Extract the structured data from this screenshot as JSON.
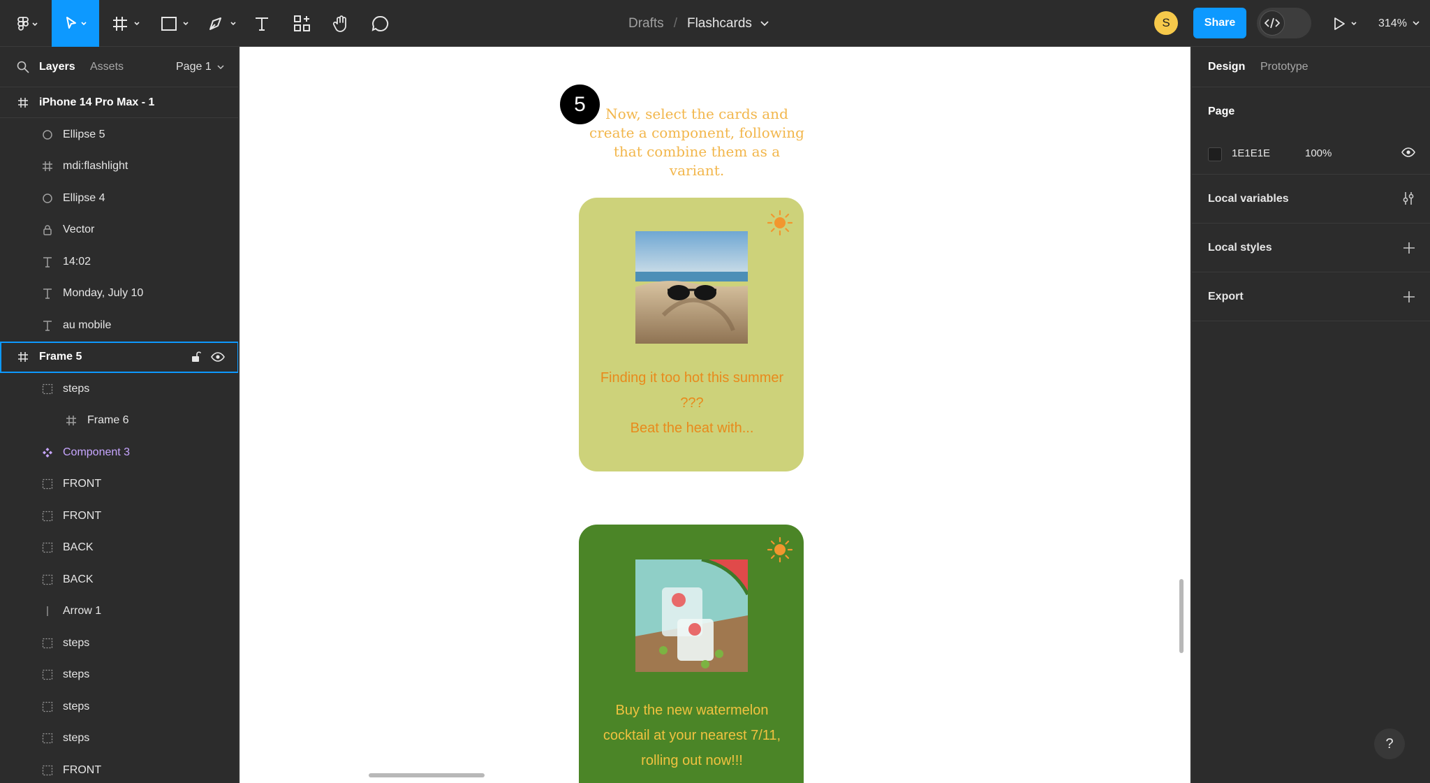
{
  "toolbar": {
    "breadcrumb_parent": "Drafts",
    "breadcrumb_sep": "/",
    "file_name": "Flashcards",
    "avatar_initial": "S",
    "share_label": "Share",
    "zoom": "314%"
  },
  "left_panel": {
    "tab_layers": "Layers",
    "tab_assets": "Assets",
    "page_selector": "Page 1",
    "root_frame": "iPhone 14 Pro Max - 1",
    "layers": [
      {
        "label": "Ellipse 5",
        "icon": "ellipse-icon"
      },
      {
        "label": "mdi:flashlight",
        "icon": "frame-icon"
      },
      {
        "label": "Ellipse 4",
        "icon": "ellipse-icon"
      },
      {
        "label": "Vector",
        "icon": "vector-icon"
      },
      {
        "label": "14:02",
        "icon": "text-icon"
      },
      {
        "label": "Monday, July 10",
        "icon": "text-icon"
      },
      {
        "label": "au mobile",
        "icon": "text-icon"
      },
      {
        "label": "Frame 5",
        "icon": "frame-icon"
      },
      {
        "label": "steps",
        "icon": "group-icon"
      },
      {
        "label": "Frame 6",
        "icon": "frame-icon"
      },
      {
        "label": "Component 3",
        "icon": "component-icon"
      },
      {
        "label": "FRONT",
        "icon": "group-icon"
      },
      {
        "label": "FRONT",
        "icon": "group-icon"
      },
      {
        "label": "BACK",
        "icon": "group-icon"
      },
      {
        "label": "BACK",
        "icon": "group-icon"
      },
      {
        "label": "Arrow 1",
        "icon": "line-icon"
      },
      {
        "label": "steps",
        "icon": "group-icon"
      },
      {
        "label": "steps",
        "icon": "group-icon"
      },
      {
        "label": "steps",
        "icon": "group-icon"
      },
      {
        "label": "steps",
        "icon": "group-icon"
      },
      {
        "label": "FRONT",
        "icon": "group-icon"
      }
    ]
  },
  "canvas": {
    "step_number": "5",
    "instruction": "Now, select the cards and create a component, following that combine them as a variant.",
    "card1_text": "Finding it too hot this summer ???\nBeat the heat with...",
    "card2_text": "Buy the new watermelon cocktail at your nearest 7/11, rolling out now!!!",
    "card1_color": "#cdd27a",
    "card2_color": "#4b8527"
  },
  "right_panel": {
    "tab_design": "Design",
    "tab_prototype": "Prototype",
    "page_heading": "Page",
    "page_color_hex": "1E1E1E",
    "page_opacity": "100%",
    "local_variables": "Local variables",
    "local_styles": "Local styles",
    "export": "Export"
  },
  "help_label": "?"
}
